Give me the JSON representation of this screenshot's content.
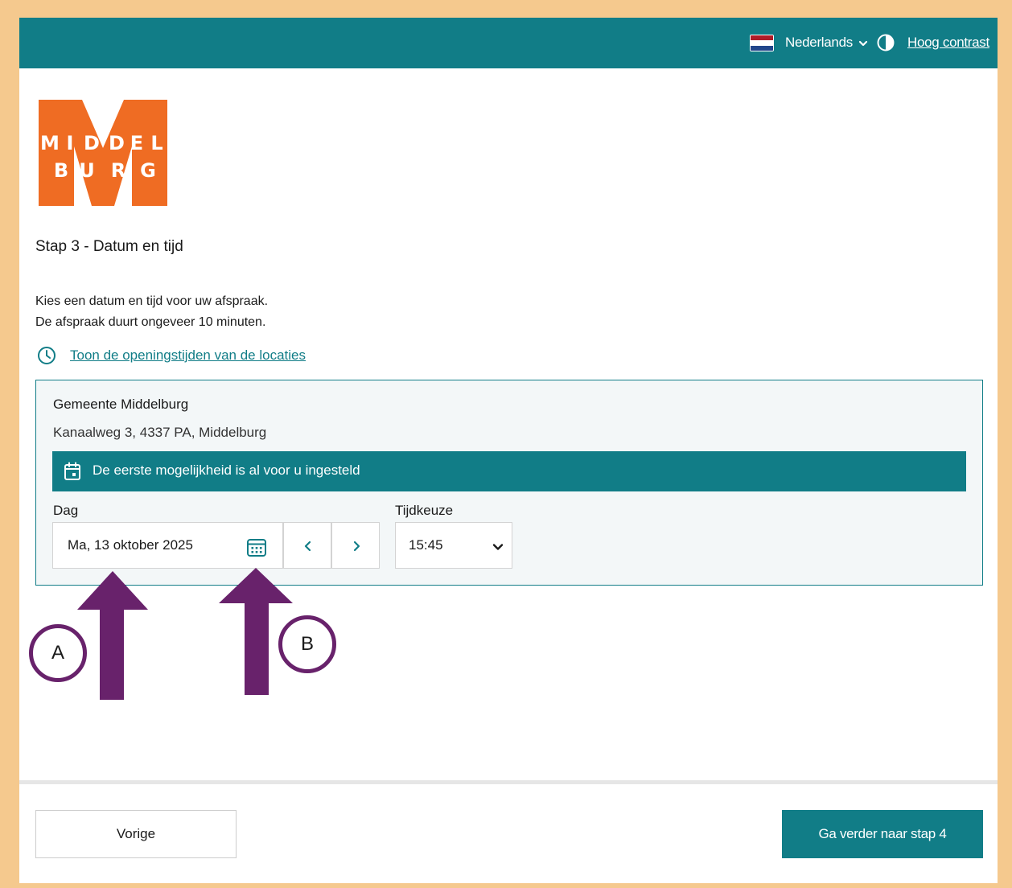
{
  "header": {
    "language": "Nederlands",
    "contrast_link": "Hoog contrast",
    "flag_colors": [
      "#ae1c28",
      "#ffffff",
      "#21468b"
    ]
  },
  "logo": {
    "line1": "MIDDEL",
    "line2": "BURG",
    "color": "#ef6c23"
  },
  "page": {
    "step_title": "Stap 3 - Datum en tijd",
    "intro_line1": "Kies een datum en tijd voor uw afspraak.",
    "intro_line2": "De afspraak duurt ongeveer 10 minuten.",
    "hours_link": "Toon de openingstijden van de locaties"
  },
  "location": {
    "name": "Gemeente Middelburg",
    "address": "Kanaalweg 3, 4337 PA, Middelburg",
    "banner": "De eerste mogelijkheid is al voor u ingesteld"
  },
  "form": {
    "day_label": "Dag",
    "day_value": "Ma, 13 oktober 2025",
    "time_label": "Tijdkeuze",
    "time_value": "15:45"
  },
  "annotations": {
    "marker_a": "A",
    "marker_b": "B",
    "color": "#68226b"
  },
  "footer": {
    "prev_label": "Vorige",
    "next_label": "Ga verder naar stap 4"
  },
  "colors": {
    "accent": "#117d87",
    "frame": "#f5c98e"
  }
}
